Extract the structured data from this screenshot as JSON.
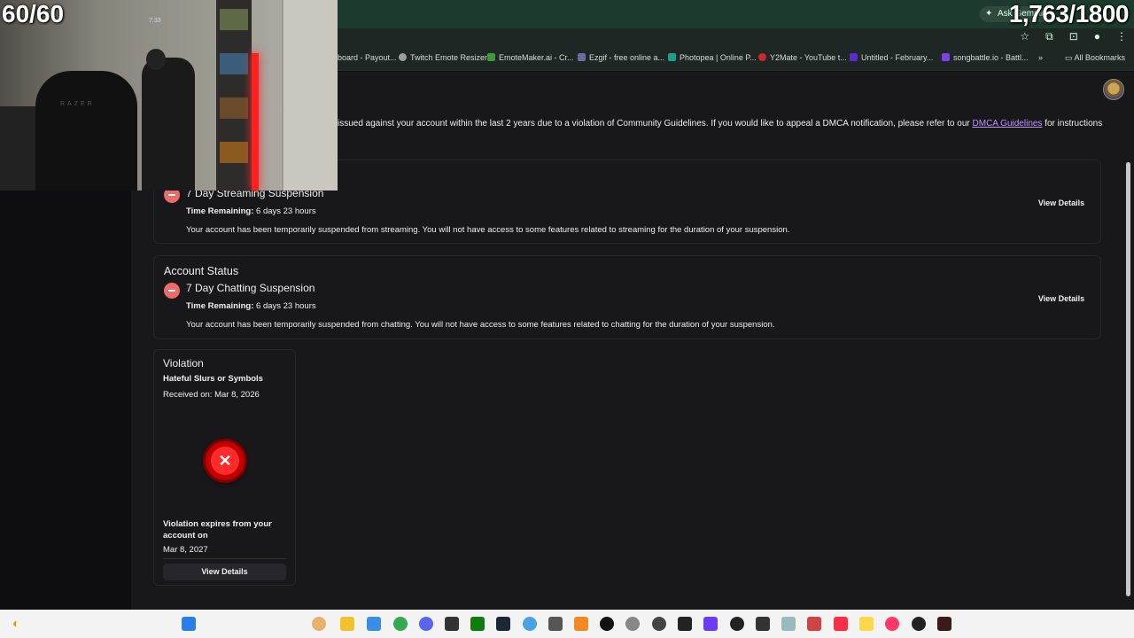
{
  "stream_overlay": {
    "fps_counter": "60/60",
    "goal_counter": "1,763/1800",
    "cam_timestamp": "7:33",
    "chair_brand": "RAZER"
  },
  "browser": {
    "extension_badge": "Ask Gemini",
    "bookmarks": [
      {
        "label": "board - Payout...",
        "color": "#7b7b7b"
      },
      {
        "label": "Twitch Emote Resizer",
        "color": "#9d9d9d"
      },
      {
        "label": "EmoteMaker.ai - Cr...",
        "color": "#3c9a3c"
      },
      {
        "label": "Ezgif - free online a...",
        "color": "#6c6c9c"
      },
      {
        "label": "Photopea | Online P...",
        "color": "#1aa08c"
      },
      {
        "label": "Y2Mate - YouTube t...",
        "color": "#cc2a2a"
      },
      {
        "label": "Untitled - February...",
        "color": "#5b2bd0"
      },
      {
        "label": "songbattle.io - Battl...",
        "color": "#8040e0"
      }
    ],
    "all_bookmarks": "All Bookmarks"
  },
  "notice": {
    "text": "issued against your account within the last 2 years due to a violation of Community Guidelines. If you would like to appeal a DMCA notification, please refer to our",
    "link": "DMCA Guidelines",
    "tail": "for instructions"
  },
  "streaming_card": {
    "title": "7 Day Streaming Suspension",
    "time_label": "Time Remaining:",
    "time_value": "6 days 23 hours",
    "description": "Your account has been temporarily suspended from streaming. You will not have access to some features related to streaming for the duration of your suspension.",
    "button": "View Details"
  },
  "chatting_card": {
    "heading": "Account Status",
    "title": "7 Day Chatting Suspension",
    "time_label": "Time Remaining:",
    "time_value": "6 days 23 hours",
    "description": "Your account has been temporarily suspended from chatting. You will not have access to some features related to chatting for the duration of your suspension.",
    "button": "View Details"
  },
  "violation_card": {
    "heading": "Violation",
    "type": "Hateful Slurs or Symbols",
    "received": "Received on: Mar 8, 2026",
    "icon_glyph": "✕",
    "expires_line1": "Violation expires from your",
    "expires_line2": "account on",
    "expires_date": "Mar 8, 2027",
    "button": "View Details"
  }
}
